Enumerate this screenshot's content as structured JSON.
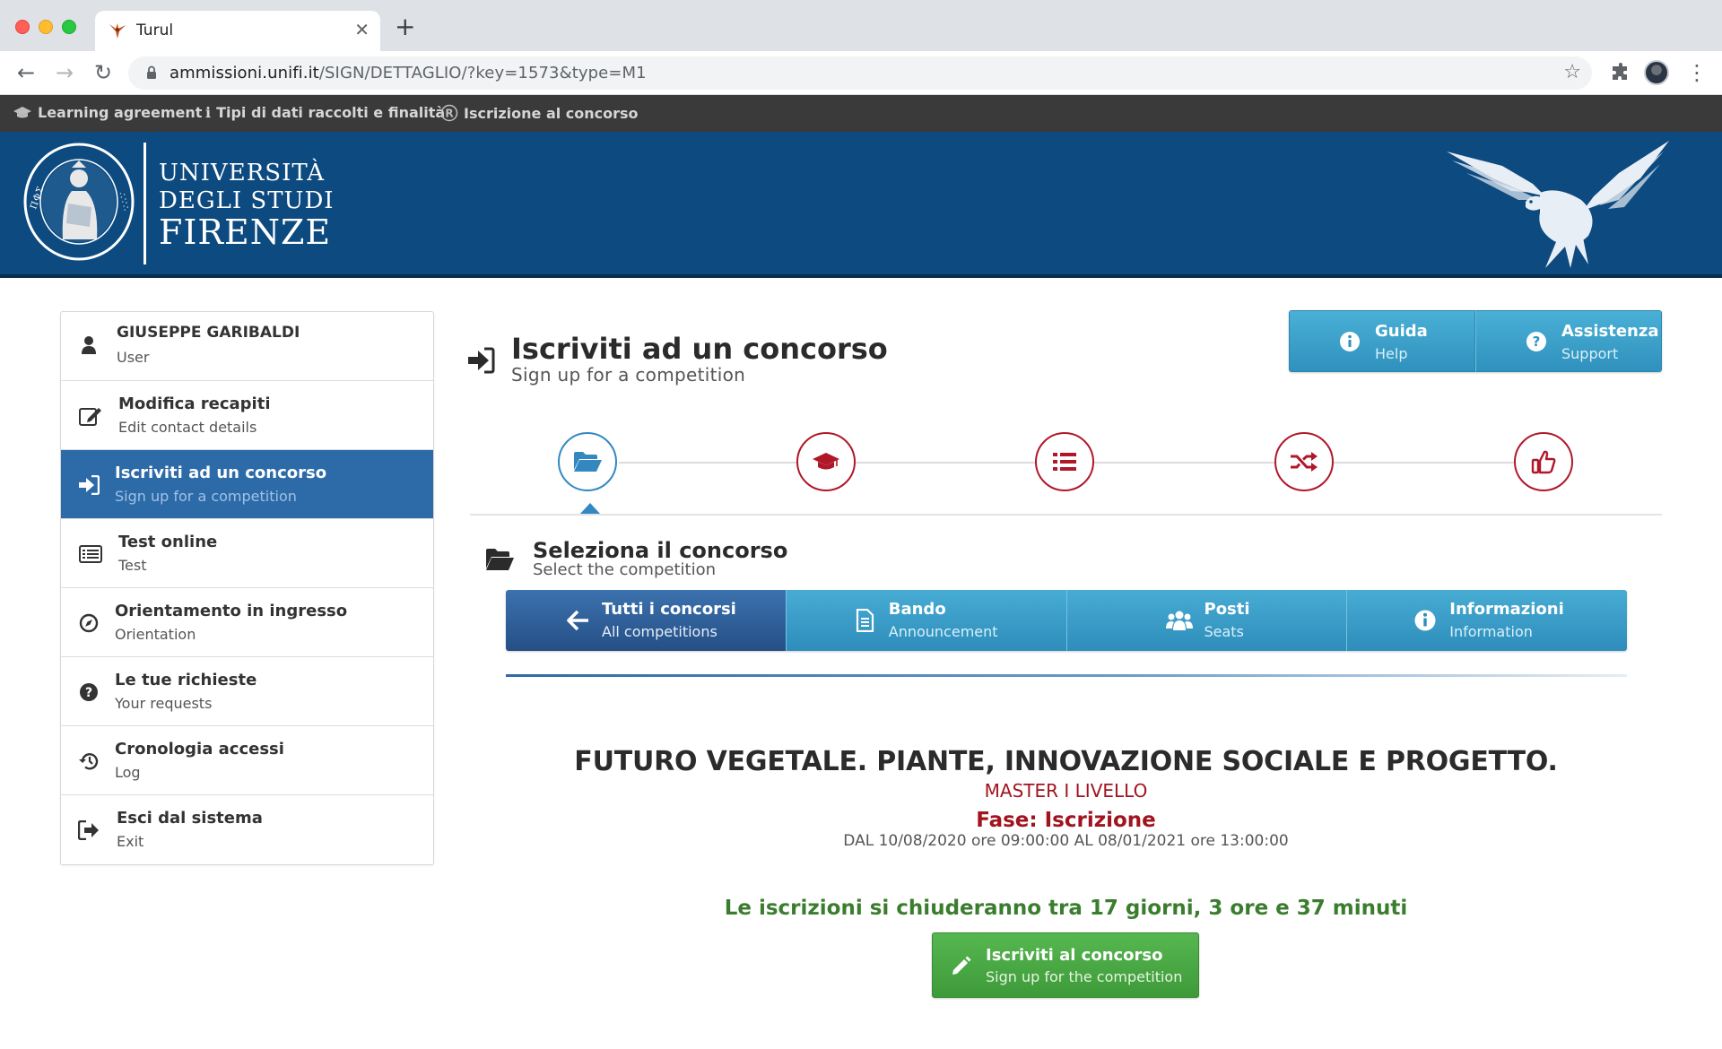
{
  "browser": {
    "tab_title": "Turul",
    "url_host": "ammissioni.unifi.it",
    "url_path": "/SIGN/DETTAGLIO/?key=1573&type=M1",
    "colors": {
      "tabstrip": "#dee1e6",
      "omnibox": "#f1f3f4"
    }
  },
  "bookmarks": [
    {
      "label": "Learning agreement",
      "icon": "graduation-cap-icon"
    },
    {
      "label": "Tipi di dati raccolti e finalità",
      "icon": "info-icon"
    },
    {
      "label": "Iscrizione al concorso",
      "icon": "registered-icon"
    }
  ],
  "site": {
    "logo_line1": "UNIVERSITÀ",
    "logo_line2": "DEGLI STUDI",
    "logo_line3": "FIRENZE",
    "header_color": "#0c4a7f"
  },
  "sidebar": {
    "items": [
      {
        "label": "GIUSEPPE GARIBALDI",
        "sub": "User",
        "icon": "user-icon"
      },
      {
        "label": "Modifica recapiti",
        "sub": "Edit contact details",
        "icon": "edit-icon"
      },
      {
        "label": "Iscriviti ad un concorso",
        "sub": "Sign up for a competition",
        "icon": "sign-in-icon",
        "active": true
      },
      {
        "label": "Test online",
        "sub": "Test",
        "icon": "list-alt-icon"
      },
      {
        "label": "Orientamento in ingresso",
        "sub": "Orientation",
        "icon": "compass-icon"
      },
      {
        "label": "Le tue richieste",
        "sub": "Your requests",
        "icon": "question-icon"
      },
      {
        "label": "Cronologia accessi",
        "sub": "Log",
        "icon": "history-icon"
      },
      {
        "label": "Esci dal sistema",
        "sub": "Exit",
        "icon": "sign-out-icon"
      }
    ]
  },
  "page": {
    "title": "Iscriviti ad un concorso",
    "subtitle": "Sign up for a competition"
  },
  "help": {
    "guida_label": "Guida",
    "guida_sub": "Help",
    "assistenza_label": "Assistenza",
    "assistenza_sub": "Support"
  },
  "steps": [
    {
      "icon": "folder-open-icon",
      "current": true
    },
    {
      "icon": "graduation-cap-icon"
    },
    {
      "icon": "list-icon"
    },
    {
      "icon": "random-icon"
    },
    {
      "icon": "thumbs-up-icon"
    }
  ],
  "section": {
    "title": "Seleziona il concorso",
    "subtitle": "Select the competition"
  },
  "actions": [
    {
      "label": "Tutti i concorsi",
      "sub": "All competitions",
      "icon": "arrow-left-icon",
      "active": true
    },
    {
      "label": "Bando",
      "sub": "Announcement",
      "icon": "file-text-icon"
    },
    {
      "label": "Posti",
      "sub": "Seats",
      "icon": "users-icon"
    },
    {
      "label": "Informazioni",
      "sub": "Information",
      "icon": "info-circle-icon"
    }
  ],
  "competition": {
    "title": "FUTURO VEGETALE. PIANTE, INNOVAZIONE SOCIALE E PROGETTO.",
    "level": "MASTER I LIVELLO",
    "phase": "Fase: Iscrizione",
    "dates": "DAL 10/08/2020 ore 09:00:00 AL 08/01/2021 ore 13:00:00",
    "countdown": "Le iscrizioni si chiuderanno tra 17 giorni, 3 ore e 37 minuti"
  },
  "signup": {
    "label": "Iscriviti al concorso",
    "sub": "Sign up for the competition"
  },
  "colors": {
    "accent_blue": "#3488c2",
    "active_blue": "#2d6aa8",
    "step_red": "#b0182a",
    "title_red": "#a0141f",
    "countdown_green": "#3b7d2e",
    "button_green": "#4aa944"
  }
}
